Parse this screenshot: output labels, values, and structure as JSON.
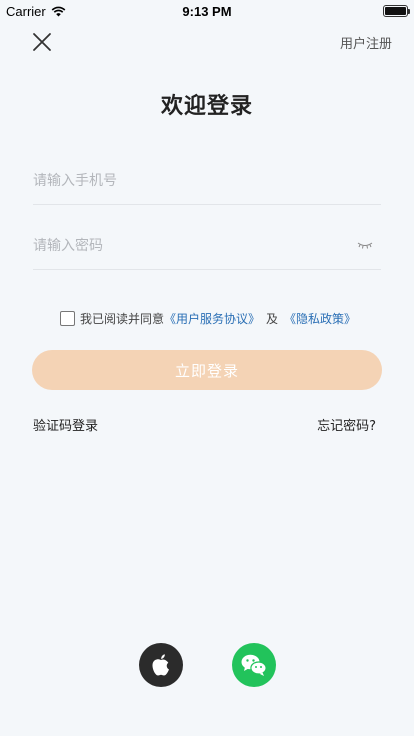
{
  "status_bar": {
    "carrier": "Carrier",
    "time": "9:13 PM",
    "battery_level": 1.0
  },
  "header": {
    "close_icon": "close-icon",
    "register_label": "用户注册"
  },
  "title": "欢迎登录",
  "form": {
    "phone_placeholder": "请输入手机号",
    "password_placeholder": "请输入密码",
    "password_toggle_icon": "eye-closed-icon"
  },
  "agreement": {
    "prefix": "我已阅读并同意",
    "service_link": "《用户服务协议》",
    "separator": "及",
    "privacy_link": "《隐私政策》",
    "checked": false
  },
  "login_button": "立即登录",
  "links": {
    "sms_login": "验证码登录",
    "forgot_password": "忘记密码?"
  },
  "social": {
    "apple_icon": "apple-icon",
    "wechat_icon": "wechat-icon"
  },
  "colors": {
    "background": "#f4f7fa",
    "login_button_bg": "#f4d3b5",
    "link": "#2a6fb5",
    "wechat_green": "#22c35b",
    "apple_dark": "#2b2b2b"
  }
}
